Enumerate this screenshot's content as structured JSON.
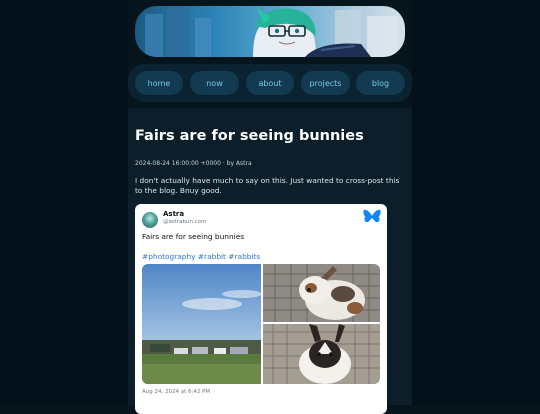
{
  "nav": {
    "items": [
      {
        "label": "home"
      },
      {
        "label": "now"
      },
      {
        "label": "about"
      },
      {
        "label": "projects"
      },
      {
        "label": "blog"
      }
    ]
  },
  "post": {
    "title": "Fairs are for seeing bunnies",
    "meta": "2024-08-24 16:00:00 +0000 · by Astra",
    "body": "I don't actually have much to say on this. Just wanted to cross-post this to the blog. Bnuy good."
  },
  "embed": {
    "author_name": "Astra",
    "author_handle": "@astrabun.com",
    "text": "Fairs are for seeing bunnies",
    "tags": "#photography #rabbit #rabbits",
    "date": "Aug 24, 2024 at 6:42 PM",
    "icons": {
      "avatar": "avatar-icon",
      "service": "butterfly-icon"
    }
  },
  "colors": {
    "page_bg": "#06141c",
    "nav_button_bg": "#123a50",
    "nav_text": "#78c8e6",
    "link": "#2a78d8",
    "bluesky": "#1185fe"
  }
}
